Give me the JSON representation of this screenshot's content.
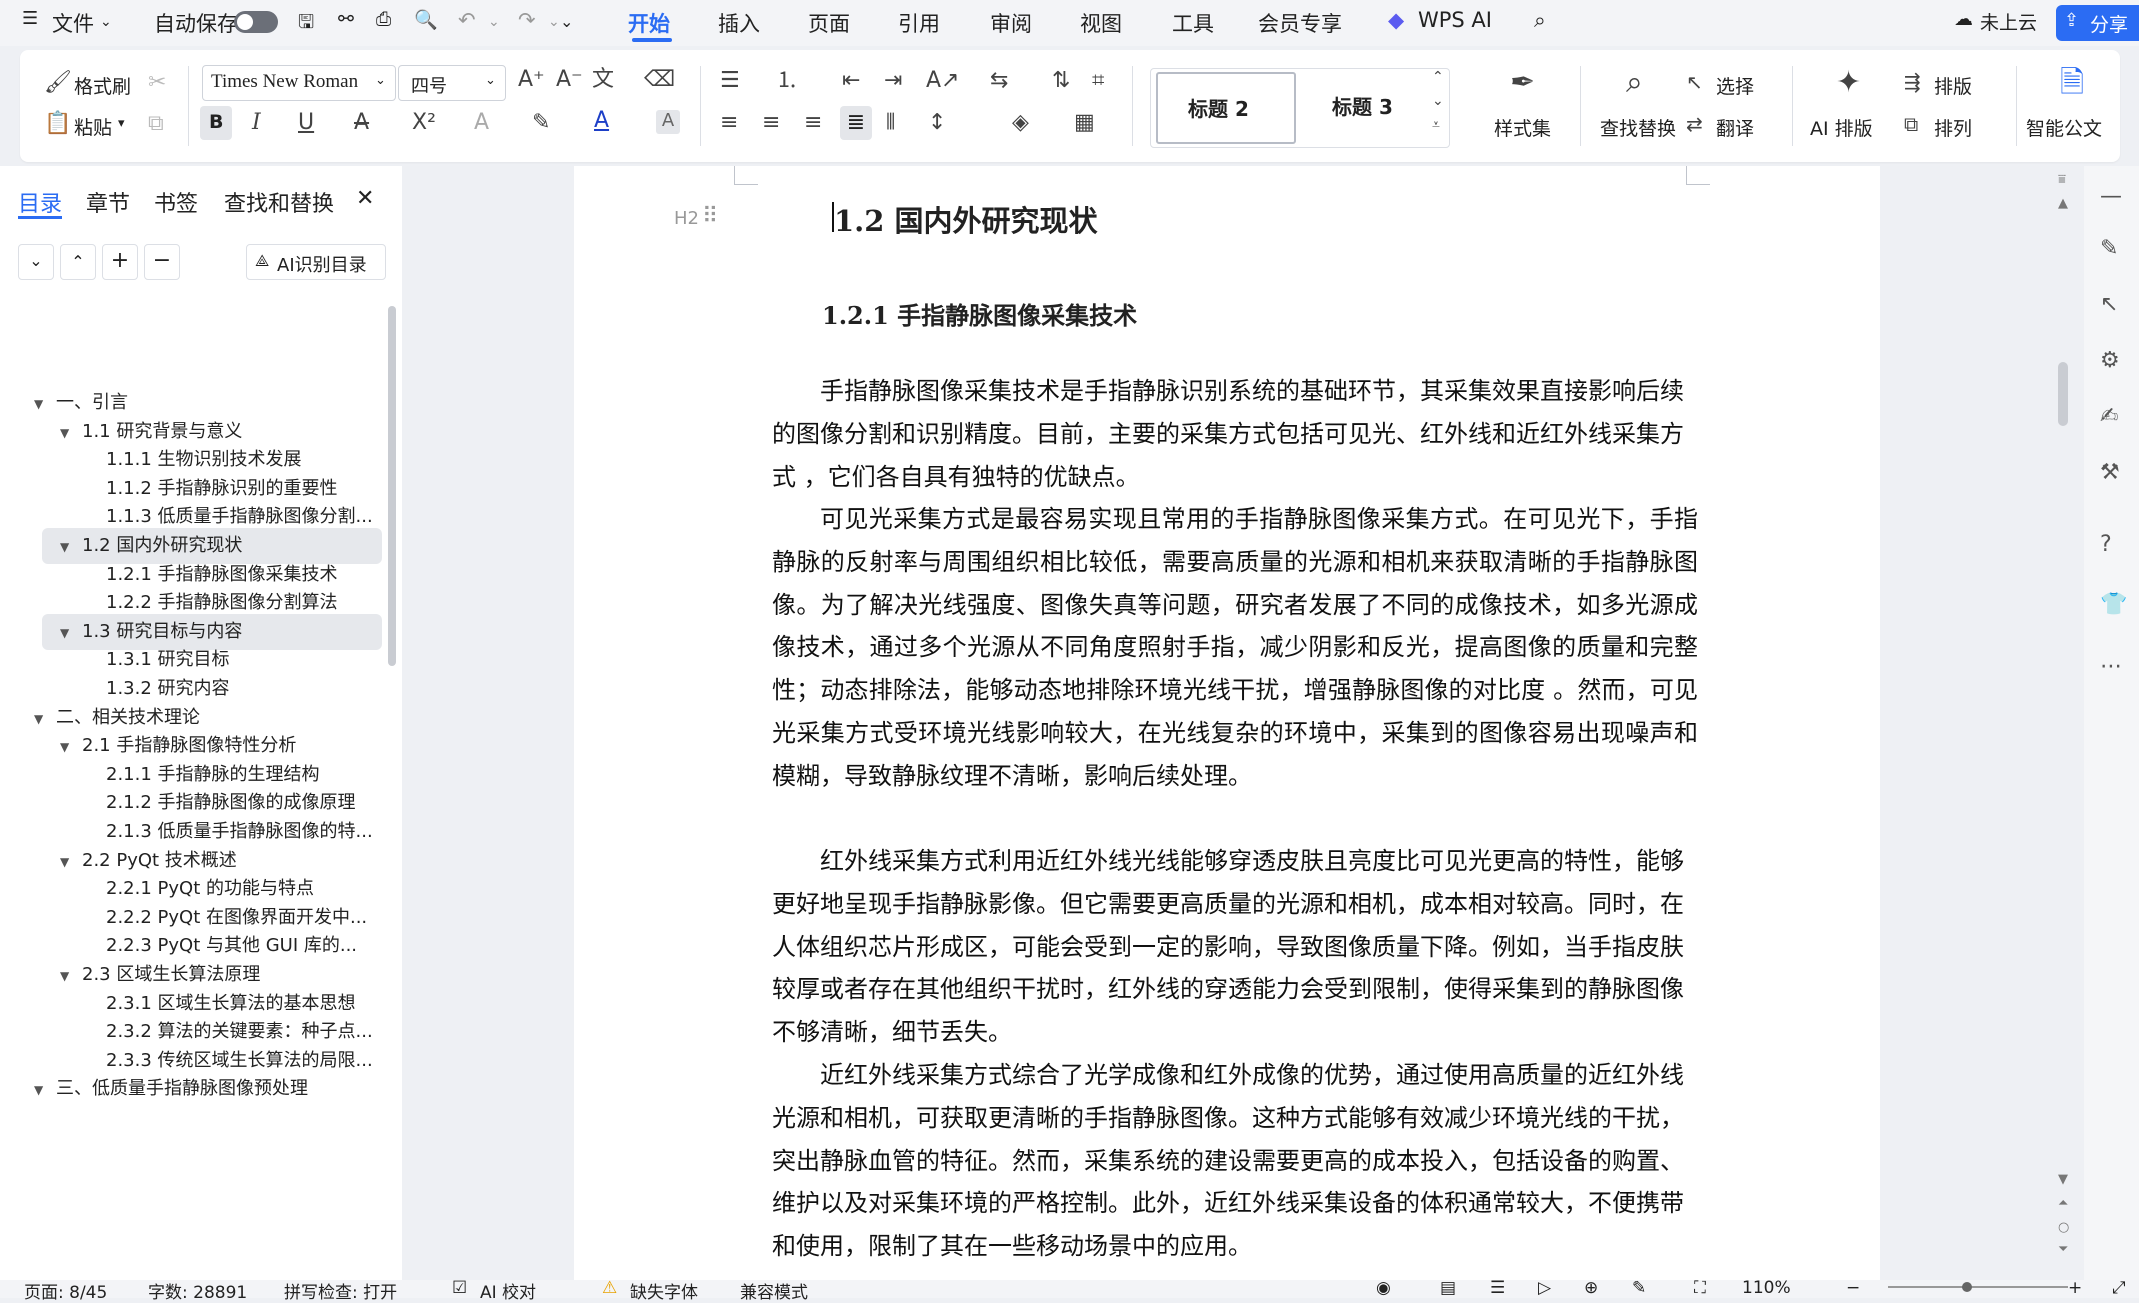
{
  "menubar": {
    "file": "文件",
    "autosave": "自动保存",
    "tabs": [
      "开始",
      "插入",
      "页面",
      "引用",
      "审阅",
      "视图",
      "工具",
      "会员专享"
    ],
    "wps_ai": "WPS AI",
    "cloud": "未上云",
    "share": "分享"
  },
  "ribbon": {
    "format_painter": "格式刷",
    "paste": "粘贴",
    "font_name": "Times New Roman",
    "font_size": "四号",
    "styles": [
      "标题 2",
      "标题 3"
    ],
    "style_set": "样式集",
    "find_replace": "查找替换",
    "select": "选择",
    "translate": "翻译",
    "ai_layout": "AI 排版",
    "layout": "排版",
    "arrange": "排列",
    "smart_doc": "智能公文"
  },
  "panel": {
    "tabs": [
      "目录",
      "章节",
      "书签",
      "查找和替换"
    ],
    "ai_toc": "AI识别目录",
    "items": [
      {
        "level": 1,
        "label": "一、引言",
        "arrow": true
      },
      {
        "level": 2,
        "label": "1.1 研究背景与意义",
        "arrow": true
      },
      {
        "level": 3,
        "label": "1.1.1 生物识别技术发展"
      },
      {
        "level": 3,
        "label": "1.1.2 手指静脉识别的重要性"
      },
      {
        "level": 3,
        "label": "1.1.3 低质量手指静脉图像分割..."
      },
      {
        "level": 2,
        "label": "1.2 国内外研究现状",
        "arrow": true,
        "highlight": true
      },
      {
        "level": 3,
        "label": "1.2.1 手指静脉图像采集技术"
      },
      {
        "level": 3,
        "label": "1.2.2 手指静脉图像分割算法"
      },
      {
        "level": 2,
        "label": "1.3 研究目标与内容",
        "arrow": true,
        "highlight": true
      },
      {
        "level": 3,
        "label": "1.3.1 研究目标"
      },
      {
        "level": 3,
        "label": "1.3.2 研究内容"
      },
      {
        "level": 1,
        "label": "二、相关技术理论",
        "arrow": true
      },
      {
        "level": 2,
        "label": "2.1 手指静脉图像特性分析",
        "arrow": true
      },
      {
        "level": 3,
        "label": "2.1.1 手指静脉的生理结构"
      },
      {
        "level": 3,
        "label": "2.1.2 手指静脉图像的成像原理"
      },
      {
        "level": 3,
        "label": "2.1.3 低质量手指静脉图像的特..."
      },
      {
        "level": 2,
        "label": "2.2 PyQt 技术概述",
        "arrow": true
      },
      {
        "level": 3,
        "label": "2.2.1 PyQt 的功能与特点"
      },
      {
        "level": 3,
        "label": "2.2.2 PyQt 在图像界面开发中..."
      },
      {
        "level": 3,
        "label": "2.2.3 PyQt 与其他 GUI 库的..."
      },
      {
        "level": 2,
        "label": "2.3 区域生长算法原理",
        "arrow": true
      },
      {
        "level": 3,
        "label": "2.3.1 区域生长算法的基本思想"
      },
      {
        "level": 3,
        "label": "2.3.2 算法的关键要素：种子点..."
      },
      {
        "level": 3,
        "label": "2.3.3 传统区域生长算法的局限..."
      },
      {
        "level": 1,
        "label": "三、低质量手指静脉图像预处理",
        "arrow": true
      }
    ]
  },
  "document": {
    "heading_marker": "H2",
    "heading2": "1.2  国内外研究现状",
    "heading3": "1.2.1  手指静脉图像采集技术",
    "paragraphs": [
      "手指静脉图像采集技术是手指静脉识别系统的基础环节，其采集效果直接影响后续的图像分割和识别精度。目前，主要的采集方式包括可见光、红外线和近红外线采集方式 ，它们各自具有独特的优缺点。",
      "可见光采集方式是最容易实现且常用的手指静脉图像采集方式。在可见光下，手指静脉的反射率与周围组织相比较低，需要高质量的光源和相机来获取清晰的手指静脉图像。为了解决光线强度、图像失真等问题，研究者发展了不同的成像技术，如多光源成像技术，通过多个光源从不同角度照射手指，减少阴影和反光，提高图像的质量和完整性；动态排除法，能够动态地排除环境光线干扰，增强静脉图像的对比度 。然而，可见光采集方式受环境光线影响较大，在光线复杂的环境中，采集到的图像容易出现噪声和模糊，导致静脉纹理不清晰，影响后续处理。",
      "红外线采集方式利用近红外线光线能够穿透皮肤且亮度比可见光更高的特性，能够更好地呈现手指静脉影像。但它需要更高质量的光源和相机，成本相对较高。同时，在人体组织芯片形成区，可能会受到一定的影响，导致图像质量下降。例如，当手指皮肤较厚或者存在其他组织干扰时，红外线的穿透能力会受到限制，使得采集到的静脉图像不够清晰，细节丢失。",
      "近红外线采集方式综合了光学成像和红外成像的优势，通过使用高质量的近红外线光源和相机，可获取更清晰的手指静脉图像。这种方式能够有效减少环境光线的干扰，突出静脉血管的特征。然而，采集系统的建设需要更高的成本投入，包括设备的购置、维护以及对采集环境的严格控制。此外，近红外线采集设备的体积通常较大，不便携带和使用，限制了其在一些移动场景中的应用。"
    ]
  },
  "status": {
    "page": "页面: 8/45",
    "words": "字数: 28891",
    "spell": "拼写检查: 打开",
    "ai_check": "AI 校对",
    "missing_font": "缺失字体",
    "compat": "兼容模式",
    "zoom": "110%"
  },
  "colors": {
    "accent": "#2b6cf3",
    "panel_highlight": "#e6e8ec"
  }
}
